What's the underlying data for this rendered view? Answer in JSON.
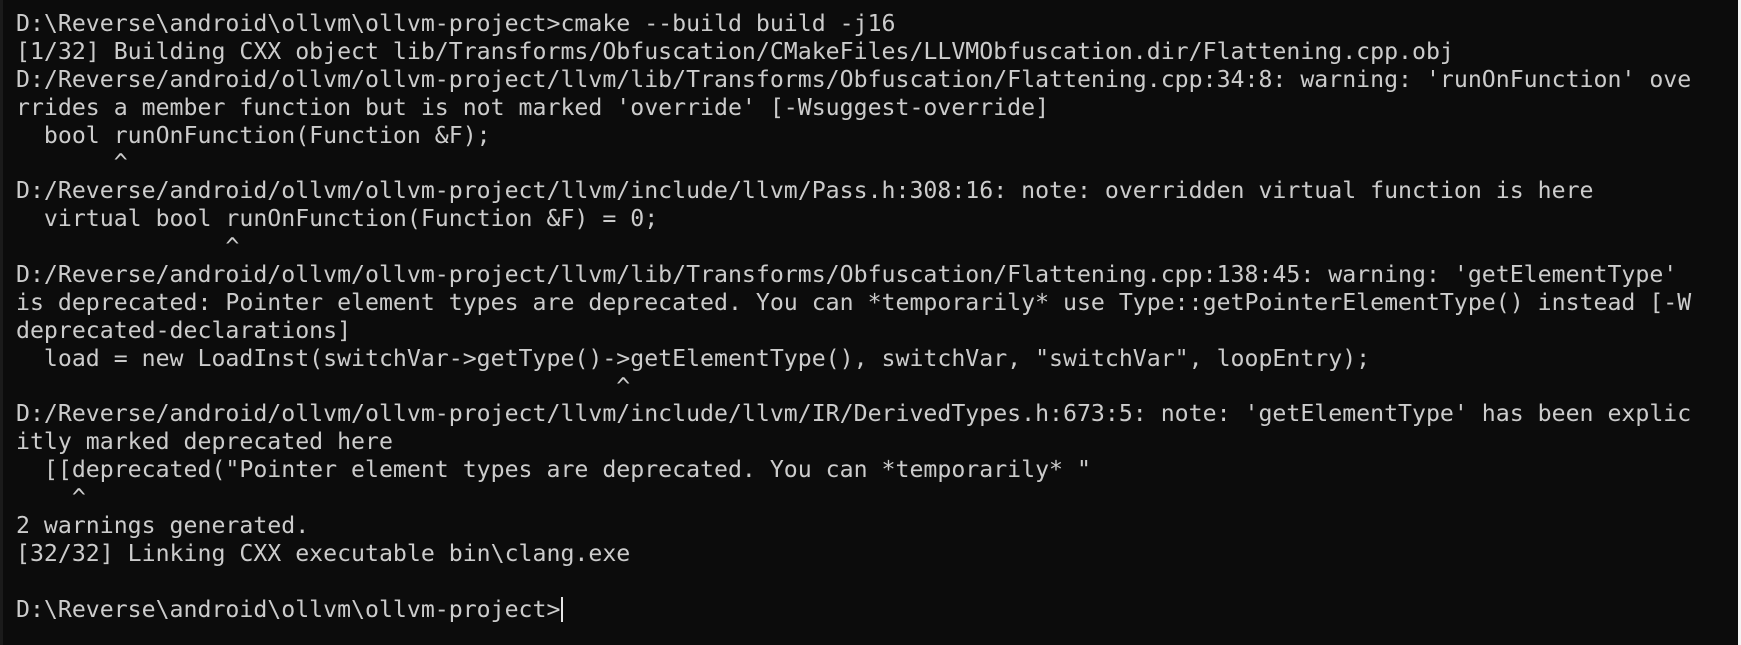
{
  "terminal": {
    "lines": [
      "D:\\Reverse\\android\\ollvm\\ollvm-project>cmake --build build -j16",
      "[1/32] Building CXX object lib/Transforms/Obfuscation/CMakeFiles/LLVMObfuscation.dir/Flattening.cpp.obj",
      "D:/Reverse/android/ollvm/ollvm-project/llvm/lib/Transforms/Obfuscation/Flattening.cpp:34:8: warning: 'runOnFunction' ove",
      "rrides a member function but is not marked 'override' [-Wsuggest-override]",
      "  bool runOnFunction(Function &F);",
      "       ^",
      "D:/Reverse/android/ollvm/ollvm-project/llvm/include/llvm/Pass.h:308:16: note: overridden virtual function is here",
      "  virtual bool runOnFunction(Function &F) = 0;",
      "               ^",
      "D:/Reverse/android/ollvm/ollvm-project/llvm/lib/Transforms/Obfuscation/Flattening.cpp:138:45: warning: 'getElementType'",
      "is deprecated: Pointer element types are deprecated. You can *temporarily* use Type::getPointerElementType() instead [-W",
      "deprecated-declarations]",
      "  load = new LoadInst(switchVar->getType()->getElementType(), switchVar, \"switchVar\", loopEntry);",
      "                                           ^",
      "D:/Reverse/android/ollvm/ollvm-project/llvm/include/llvm/IR/DerivedTypes.h:673:5: note: 'getElementType' has been explic",
      "itly marked deprecated here",
      "  [[deprecated(\"Pointer element types are deprecated. You can *temporarily* \"",
      "    ^",
      "2 warnings generated.",
      "[32/32] Linking CXX executable bin\\clang.exe",
      ""
    ],
    "prompt": "D:\\Reverse\\android\\ollvm\\ollvm-project>"
  }
}
